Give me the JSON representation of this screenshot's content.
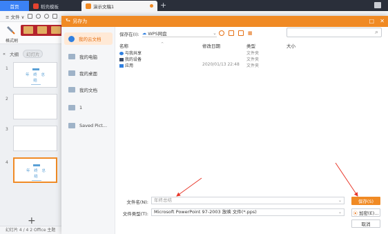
{
  "colors": {
    "accent": "#f08a24",
    "tab_blue": "#3b82f6",
    "arrow_red": "#e8372a"
  },
  "tabbar": {
    "home": "首页",
    "tabs": [
      {
        "label": "稻壳模板",
        "icon": "docer-icon"
      },
      {
        "label": "演示文稿1",
        "icon": "ppt-icon"
      }
    ],
    "new_tab": "+"
  },
  "menubar": {
    "file": "≡ 文件 ∨"
  },
  "ribbon": {
    "brush_label": "格式刷"
  },
  "left_pane": {
    "view_outline": "大纲",
    "view_slides": "幻灯片",
    "slides": [
      {
        "num": "1",
        "title": "年 终 总 结"
      },
      {
        "num": "2"
      },
      {
        "num": "3"
      },
      {
        "num": "4",
        "title": "年 终 总 结"
      }
    ],
    "add": "+"
  },
  "statusbar": {
    "text": "幻灯片 4 / 4    2 Office 主题"
  },
  "dialog": {
    "title": "另存为",
    "minimize": "□",
    "close": "✕",
    "sidebar": [
      {
        "label": "我的云文档",
        "icon": "cloud-doc-icon",
        "selected": true
      },
      {
        "label": "我的电脑",
        "icon": "computer-icon"
      },
      {
        "label": "我的桌面",
        "icon": "desktop-icon"
      },
      {
        "label": "我的文档",
        "icon": "folder-icon"
      },
      {
        "label": "1",
        "icon": "folder-icon"
      },
      {
        "label": "Saved Pict...",
        "icon": "folder-icon"
      }
    ],
    "save_in_label": "保存在(I):",
    "save_in_value": "WPS网盘",
    "columns": {
      "name": "名称",
      "date": "修改日期",
      "type": "类型",
      "size": "大小"
    },
    "files": [
      {
        "name": "与我共享",
        "date": "",
        "type": "文件夹",
        "icon": "share-icon"
      },
      {
        "name": "我的设备",
        "date": "",
        "type": "文件夹",
        "icon": "device-icon"
      },
      {
        "name": "应用",
        "date": "2020/01/13 22:48",
        "type": "文件夹",
        "icon": "app-icon"
      }
    ],
    "filename_label": "文件名(N):",
    "filename_value": "年终总结",
    "filetype_label": "文件类型(T):",
    "filetype_value": "Microsoft PowerPoint 97-2003 放映 文件(*.pps)",
    "save_button": "保存(S)",
    "encrypt_button": "加密(E)...",
    "cancel_button": "取消"
  }
}
